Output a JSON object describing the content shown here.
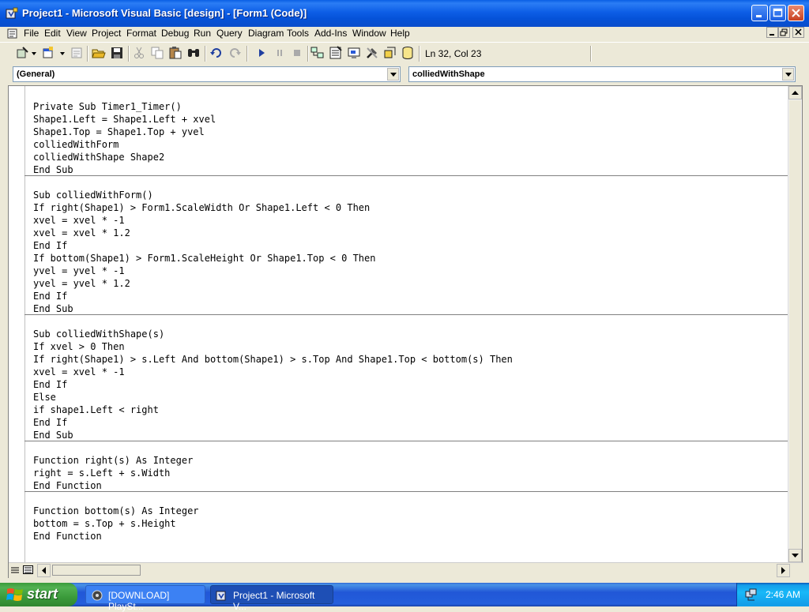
{
  "window": {
    "title": "Project1 - Microsoft Visual Basic [design] - [Form1 (Code)]"
  },
  "menubar": {
    "items": [
      "File",
      "Edit",
      "View",
      "Project",
      "Format",
      "Debug",
      "Run",
      "Query",
      "Diagram",
      "Tools",
      "Add-Ins",
      "Window",
      "Help"
    ]
  },
  "toolbar": {
    "status": "Ln 32, Col 23"
  },
  "combos": {
    "object": "(General)",
    "procedure": "colliedWithShape"
  },
  "code": {
    "lines": [
      "Private Sub Timer1_Timer()",
      "Shape1.Left = Shape1.Left + xvel",
      "Shape1.Top = Shape1.Top + yvel",
      "colliedWithForm",
      "colliedWithShape Shape2",
      "End Sub",
      "",
      "Sub colliedWithForm()",
      "If right(Shape1) > Form1.ScaleWidth Or Shape1.Left < 0 Then",
      "xvel = xvel * -1",
      "xvel = xvel * 1.2",
      "End If",
      "If bottom(Shape1) > Form1.ScaleHeight Or Shape1.Top < 0 Then",
      "yvel = yvel * -1",
      "yvel = yvel * 1.2",
      "End If",
      "End Sub",
      "",
      "Sub colliedWithShape(s)",
      "If xvel > 0 Then",
      "If right(Shape1) > s.Left And bottom(Shape1) > s.Top And Shape1.Top < bottom(s) Then",
      "xvel = xvel * -1",
      "End If",
      "Else",
      "if shape1.Left < right",
      "End If",
      "End Sub",
      "",
      "Function right(s) As Integer",
      "right = s.Left + s.Width",
      "End Function",
      "",
      "Function bottom(s) As Integer",
      "bottom = s.Top + s.Height",
      "End Function"
    ]
  },
  "taskbar": {
    "start_label": "start",
    "tasks": [
      "[DOWNLOAD] PlaySt...",
      "Project1 - Microsoft V..."
    ],
    "clock": "2:46 AM"
  }
}
